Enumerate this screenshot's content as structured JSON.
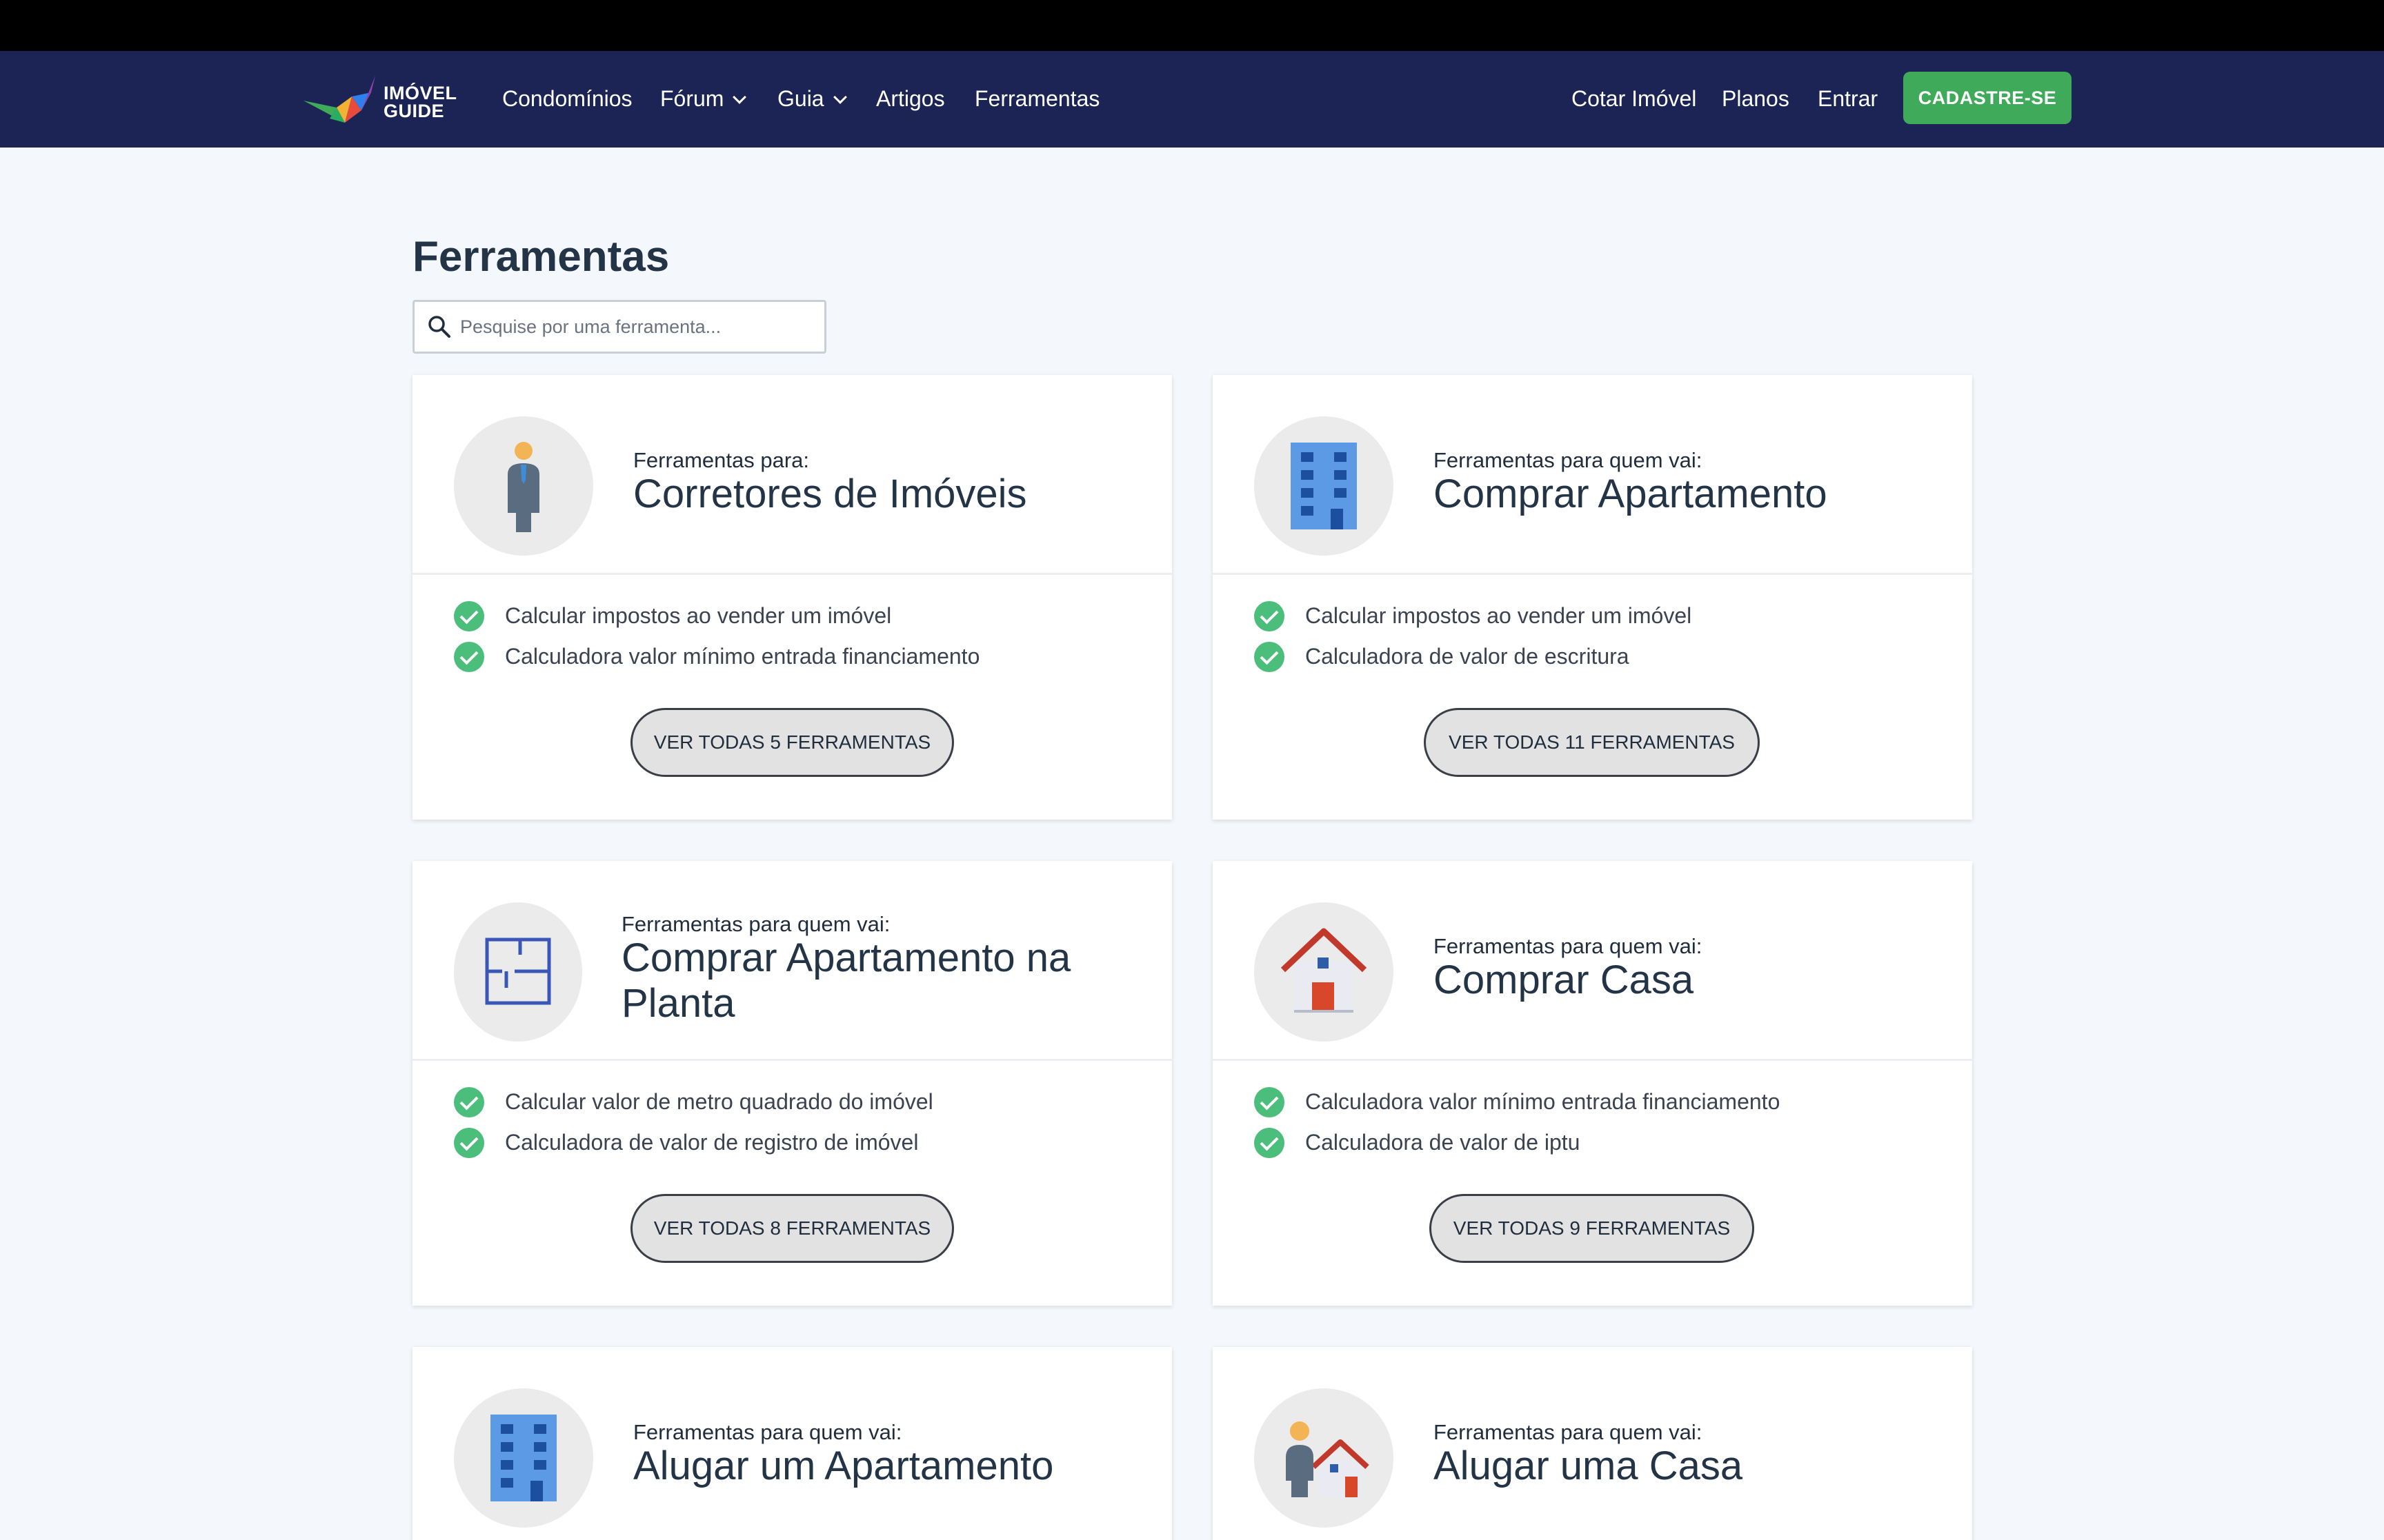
{
  "nav": {
    "logo_line1": "IMÓVEL",
    "logo_line2": "GUIDE",
    "links": [
      "Condomínios",
      "Fórum",
      "Guia",
      "Artigos",
      "Ferramentas"
    ],
    "right_links": [
      "Cotar Imóvel",
      "Planos",
      "Entrar"
    ],
    "signup": "CADASTRE-SE"
  },
  "page": {
    "title": "Ferramentas",
    "search_placeholder": "Pesquise por uma ferramenta..."
  },
  "colors": {
    "nav_bg": "#1b2455",
    "signup": "#3faa5a",
    "check": "#4cbe7b",
    "page_bg": "#f4f8fc"
  },
  "cards": [
    {
      "icon": "person-tie-icon",
      "subtitle": "Ferramentas para:",
      "title": "Corretores de Imóveis",
      "tools": [
        "Calcular impostos ao vender um imóvel",
        "Calculadora valor mínimo entrada financiamento"
      ],
      "button": "VER TODAS 5 FERRAMENTAS"
    },
    {
      "icon": "apartment-building-icon",
      "subtitle": "Ferramentas para quem vai:",
      "title": "Comprar Apartamento",
      "tools": [
        "Calcular impostos ao vender um imóvel",
        "Calculadora de valor de escritura"
      ],
      "button": "VER TODAS 11 FERRAMENTAS"
    },
    {
      "icon": "floor-plan-icon",
      "subtitle": "Ferramentas para quem vai:",
      "title": "Comprar Apartamento na Planta",
      "tools": [
        "Calcular valor de metro quadrado do imóvel",
        "Calculadora de valor de registro de imóvel"
      ],
      "button": "VER TODAS 8 FERRAMENTAS"
    },
    {
      "icon": "house-icon",
      "subtitle": "Ferramentas para quem vai:",
      "title": "Comprar Casa",
      "tools": [
        "Calculadora valor mínimo entrada financiamento",
        "Calculadora de valor de iptu"
      ],
      "button": "VER TODAS 9 FERRAMENTAS"
    },
    {
      "icon": "apartment-building-icon",
      "subtitle": "Ferramentas para quem vai:",
      "title": "Alugar um Apartamento"
    },
    {
      "icon": "person-house-icon",
      "subtitle": "Ferramentas para quem vai:",
      "title": "Alugar uma Casa"
    }
  ]
}
